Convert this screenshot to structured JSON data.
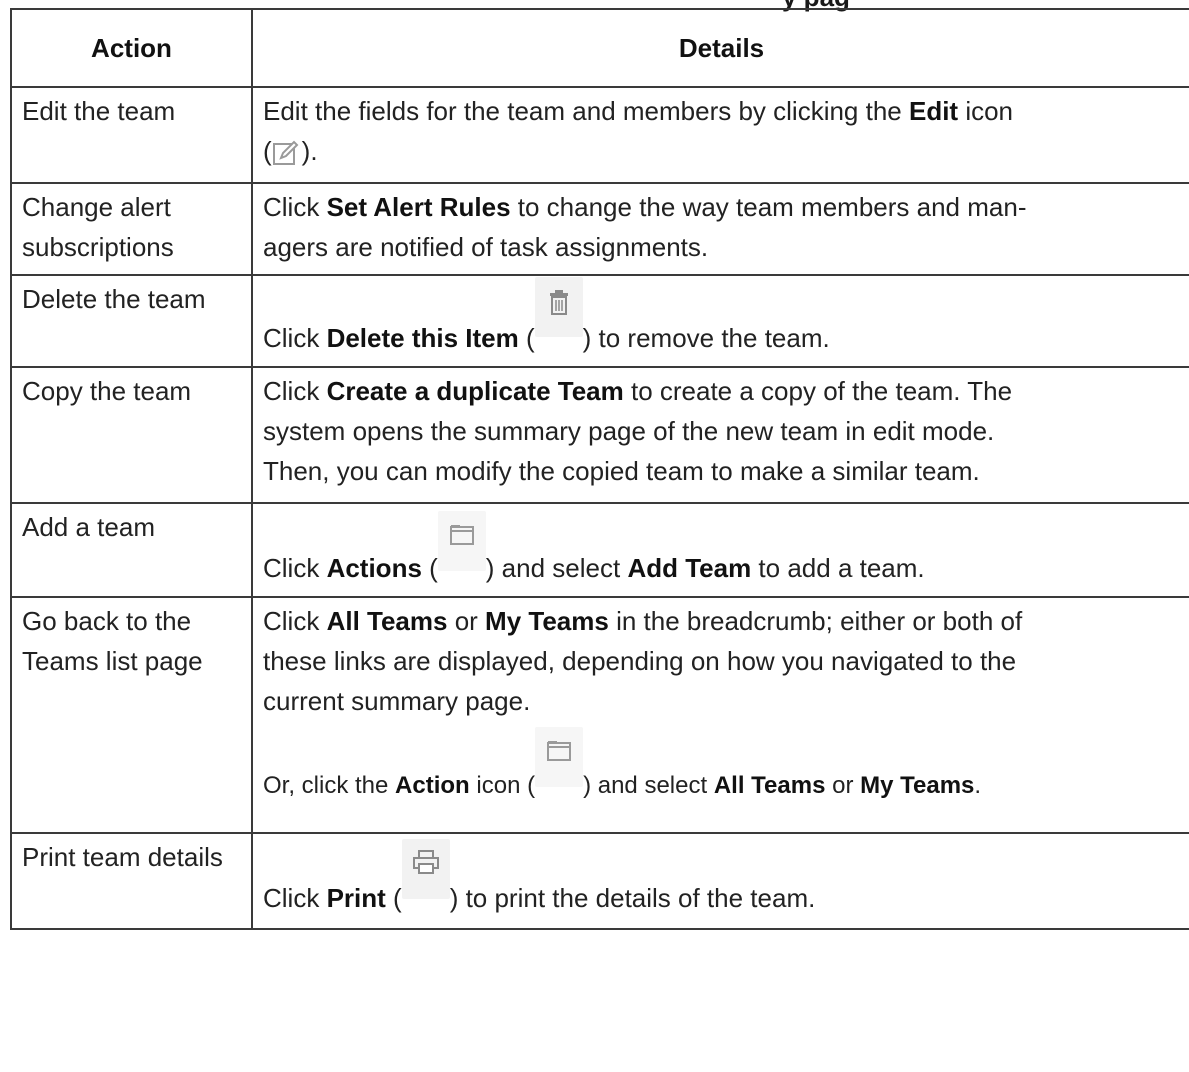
{
  "partial_heading": "y pag",
  "table": {
    "headers": {
      "action": "Action",
      "details": "Details"
    },
    "rows": [
      {
        "action": "Edit the team",
        "details": {
          "pre": "Edit the fields for the team and members by clicking the ",
          "bold1": "Edit",
          "post": " icon",
          "line2_open": "(",
          "icon": "edit-icon",
          "line2_close": ")."
        }
      },
      {
        "action": "Change alert subscriptions",
        "details": {
          "pre": "Click ",
          "bold1": "Set Alert Rules",
          "post": " to change the way team members and man-",
          "line2": "agers are notified of task assignments."
        }
      },
      {
        "action": "Delete the team",
        "details": {
          "pre": "Click ",
          "bold1": "Delete this Item",
          "open": " (",
          "icon": "trash-icon",
          "close": ") to remove the team."
        }
      },
      {
        "action": "Copy the team",
        "details": {
          "pre": "Click ",
          "bold1": "Create a duplicate Team",
          "post": " to create a copy of the team. The",
          "line2": "system opens the summary page of the new team in edit mode.",
          "line3": "Then, you can modify the copied team to make a similar team."
        }
      },
      {
        "action": "Add a team",
        "details": {
          "pre": "Click ",
          "bold1": "Actions",
          "open": " (",
          "icon": "folder-icon",
          "mid": ") and select ",
          "bold2": "Add Team",
          "post": " to add a team."
        }
      },
      {
        "action": "Go back to the Teams list page",
        "details": {
          "p1_pre": "Click ",
          "p1_bold1": "All Teams",
          "p1_mid": " or ",
          "p1_bold2": "My Teams",
          "p1_post": " in the breadcrumb; either or both of",
          "p1_line2": "these links are displayed, depending on how you navigated to the",
          "p1_line3": "current summary page.",
          "p2_pre": "Or, click the ",
          "p2_bold1": "Action",
          "p2_mid1": " icon (",
          "p2_icon": "folder-icon",
          "p2_mid2": ") and select ",
          "p2_bold2": "All Teams",
          "p2_mid3": " or ",
          "p2_bold3": "My Teams",
          "p2_post": "."
        }
      },
      {
        "action": "Print team details",
        "details": {
          "pre": "Click ",
          "bold1": "Print",
          "open": " (",
          "icon": "printer-icon",
          "close": ") to print the details of the team."
        }
      }
    ]
  }
}
